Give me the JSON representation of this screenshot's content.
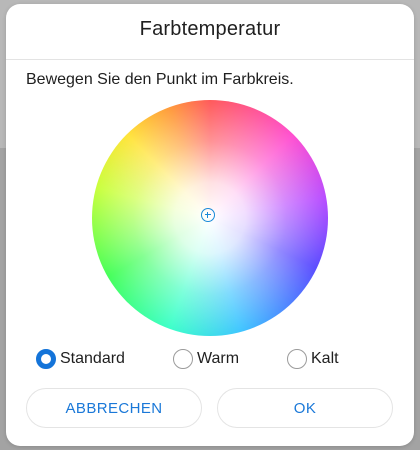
{
  "dialog": {
    "title": "Farbtemperatur",
    "instruction": "Bewegen Sie den Punkt im Farbkreis.",
    "color_wheel": {
      "icon": "crosshair-icon",
      "accent_color": "#1a8ad8"
    },
    "options": [
      {
        "label": "Standard",
        "selected": true
      },
      {
        "label": "Warm",
        "selected": false
      },
      {
        "label": "Kalt",
        "selected": false
      }
    ],
    "buttons": {
      "cancel_label": "ABBRECHEN",
      "ok_label": "OK"
    },
    "colors": {
      "accent": "#1474d9",
      "button_text": "#1a78d8"
    }
  }
}
